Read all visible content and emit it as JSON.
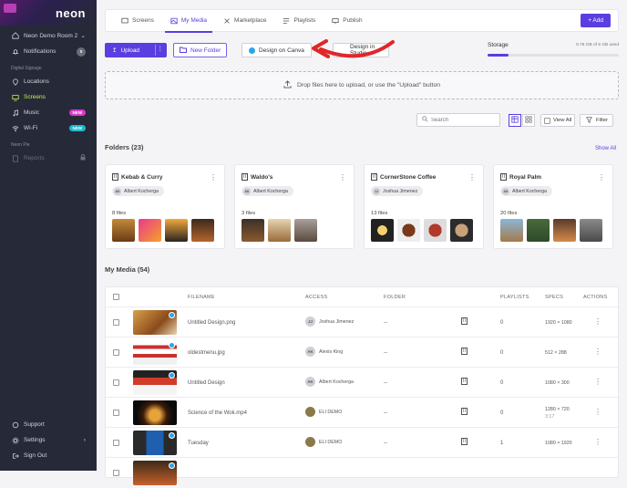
{
  "sidebar": {
    "logo": "neon",
    "workspace": "Neon Demo Room 2",
    "notifications": {
      "label": "Notifications",
      "count": "0"
    },
    "section_signage": "Digital Signage",
    "items": [
      {
        "label": "Locations",
        "icon": "location-pin-icon"
      },
      {
        "label": "Screens",
        "icon": "screen-icon",
        "active": true
      },
      {
        "label": "Music",
        "icon": "music-icon",
        "badge": "NEW"
      },
      {
        "label": "Wi-Fi",
        "icon": "wifi-icon",
        "badge": "NEW"
      }
    ],
    "section_pie": "Neon Pie",
    "reports": "Reports",
    "bottom": [
      "Support",
      "Settings",
      "Sign Out"
    ]
  },
  "topbar": {
    "tabs": [
      "Screens",
      "My Media",
      "Marketplace",
      "Playlists",
      "Publish"
    ],
    "active_tab": "My Media",
    "add_label": "+ Add"
  },
  "toolbar": {
    "upload": "Upload",
    "new_folder": "New Folder",
    "design_canva": "Design on Canva",
    "design_studio": "Design in Studio"
  },
  "storage": {
    "label": "Storage",
    "value": "0.78 GB of 5 GB used",
    "fraction": 0.16
  },
  "dropzone": "Drop files here to upload, or use the \"Upload\" button",
  "filters": {
    "search_placeholder": "Search",
    "view_all": "View All",
    "filter": "Filter"
  },
  "folders_title": "Folders (23)",
  "show_all": "Show All",
  "folders": [
    {
      "name": "Kebab & Curry",
      "owner": "Albert Kocherga",
      "initials": "AK",
      "files": "8 files"
    },
    {
      "name": "Waldo's",
      "owner": "Albert Kocherga",
      "initials": "AK",
      "files": "3 files"
    },
    {
      "name": "CornerStone Coffee",
      "owner": "Joshua Jimenez",
      "initials": "JJ",
      "files": "13 files"
    },
    {
      "name": "Royal Palm",
      "owner": "Albert Kocherga",
      "initials": "AK",
      "files": "20 files"
    }
  ],
  "media_title": "My Media (54)",
  "table": {
    "headers": [
      "FILENAME",
      "ACCESS",
      "FOLDER",
      "PLAYLISTS",
      "SPECS",
      "ACTIONS"
    ],
    "rows": [
      {
        "name": "Untitled Design.png",
        "access": "Joshua Jimenez",
        "initials": "JJ",
        "folder": "--",
        "playlists": "0",
        "specs": "1920 × 1080"
      },
      {
        "name": "oldestmenu.jpg",
        "access": "Alexis King",
        "initials": "AK",
        "folder": "--",
        "playlists": "0",
        "specs": "512 × 288"
      },
      {
        "name": "Untitled Design",
        "access": "Albert Kocherga",
        "initials": "AK",
        "folder": "--",
        "playlists": "0",
        "specs": "1080 × 300"
      },
      {
        "name": "Science of the Wok.mp4",
        "access": "ELI DEMO",
        "initials": "",
        "folder": "--",
        "playlists": "0",
        "specs": "1280 × 720",
        "specs2": "3:17"
      },
      {
        "name": "Tuesday",
        "access": "ELI DEMO",
        "initials": "",
        "folder": "--",
        "playlists": "1",
        "specs": "1080 × 1920"
      }
    ]
  },
  "colors": {
    "accent": "#5b3ee0",
    "sidebar": "#262a38",
    "active_nav": "#c6f252",
    "annotation_arrow": "#e0262b"
  }
}
